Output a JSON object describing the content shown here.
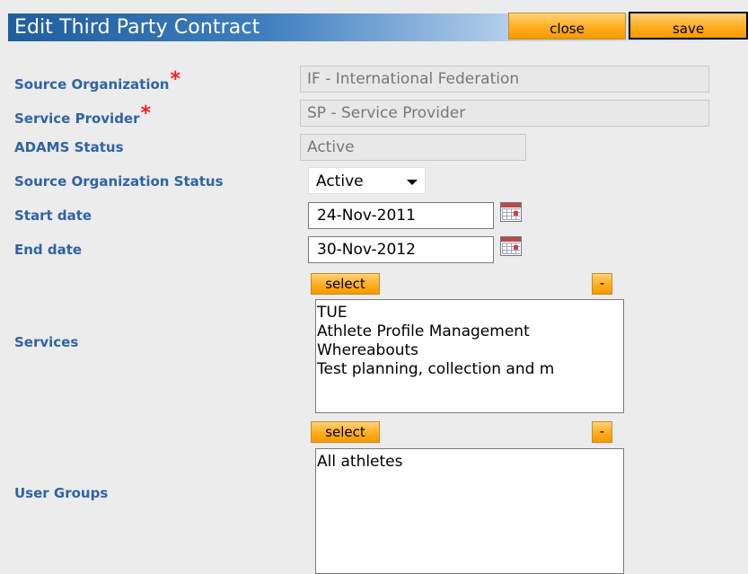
{
  "header": {
    "title": "Edit Third Party Contract",
    "close_label": "close",
    "save_label": "save"
  },
  "form": {
    "source_org": {
      "label": "Source Organization",
      "value": "IF - International Federation",
      "required": true
    },
    "service_provider": {
      "label": "Service Provider",
      "value": "SP - Service Provider",
      "required": true
    },
    "adams_status": {
      "label": "ADAMS Status",
      "value": "Active"
    },
    "source_org_status": {
      "label": "Source Organization Status",
      "selected": "Active"
    },
    "start_date": {
      "label": "Start date",
      "value": "24-Nov-2011"
    },
    "end_date": {
      "label": "End date",
      "value": "30-Nov-2012"
    },
    "services": {
      "label": "Services",
      "select_label": "select",
      "remove_label": "-",
      "items": [
        "TUE",
        "Athlete Profile Management",
        "Whereabouts",
        "Test planning, collection and m"
      ]
    },
    "user_groups": {
      "label": "User Groups",
      "select_label": "select",
      "remove_label": "-",
      "items": [
        "All athletes"
      ]
    }
  },
  "colors": {
    "label_blue": "#2f63a7",
    "title_bar": "#1f5d9c",
    "button_orange": "#ffad1f",
    "required_red": "#ff1a1a"
  },
  "icons": {
    "calendar": "calendar-icon",
    "dropdown": "chevron-down-icon"
  }
}
